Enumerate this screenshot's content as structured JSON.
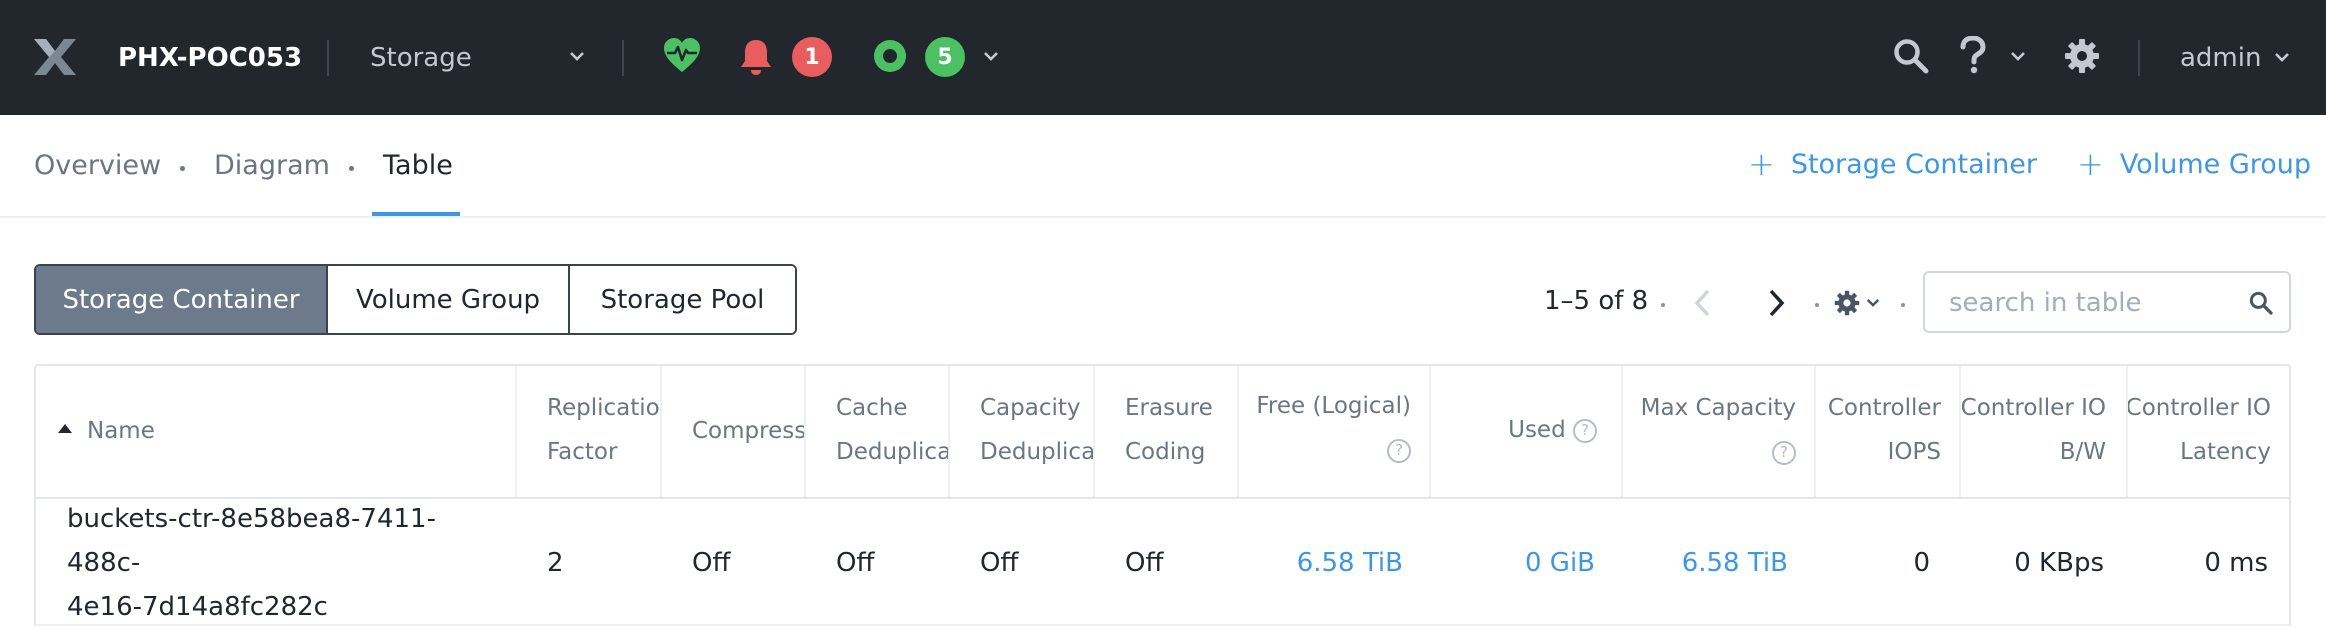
{
  "header": {
    "cluster_name": "PHX-POC053",
    "view_selector": "Storage",
    "alert_count": "1",
    "task_count": "5",
    "user_label": "admin",
    "colors": {
      "bar": "#22272e",
      "health": "#4cc164",
      "alert": "#e85d5d",
      "task": "#4cc164"
    }
  },
  "subnav": {
    "tabs": [
      {
        "label": "Overview"
      },
      {
        "label": "Diagram"
      },
      {
        "label": "Table"
      }
    ],
    "active_tab": "Table",
    "actions": [
      {
        "label": "Storage Container",
        "icon": "plus-icon"
      },
      {
        "label": "Volume Group",
        "icon": "plus-icon"
      }
    ]
  },
  "entity_switch": {
    "options": [
      {
        "label": "Storage Container"
      },
      {
        "label": "Volume Group"
      },
      {
        "label": "Storage Pool"
      }
    ],
    "selected": "Storage Container"
  },
  "pager": {
    "range_text": "1–5 of 8"
  },
  "search": {
    "placeholder": "search in table",
    "value": ""
  },
  "table": {
    "columns": [
      {
        "label": "Name",
        "sort": "ascending"
      },
      {
        "line1": "Replication",
        "line2": "Factor"
      },
      {
        "label": "Compression"
      },
      {
        "line1": "Cache",
        "line2": "Deduplication"
      },
      {
        "line1": "Capacity",
        "line2": "Deduplication"
      },
      {
        "line1": "Erasure",
        "line2": "Coding"
      },
      {
        "label": "Free (Logical)",
        "help": "?"
      },
      {
        "label": "Used",
        "help": "?"
      },
      {
        "label": "Max Capacity",
        "help": "?"
      },
      {
        "line1": "Controller",
        "line2": "IOPS"
      },
      {
        "line1": "Controller IO",
        "line2": "B/W"
      },
      {
        "line1": "Controller IO",
        "line2": "Latency"
      }
    ],
    "rows": [
      {
        "name_line1": "buckets-ctr-8e58bea8-7411-488c-",
        "name_line2": "4e16-7d14a8fc282c",
        "replication_factor": "2",
        "compression": "Off",
        "cache_dedup": "Off",
        "capacity_dedup": "Off",
        "erasure_coding": "Off",
        "free_logical": "6.58 TiB",
        "used": "0 GiB",
        "max_capacity": "6.58 TiB",
        "controller_iops": "0",
        "controller_bw": "0 KBps",
        "controller_latency": "0 ms"
      }
    ]
  }
}
